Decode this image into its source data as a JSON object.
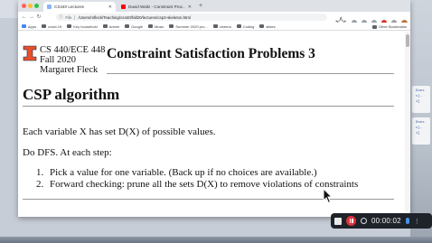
{
  "colors": {
    "accent_red": "#e8502a",
    "rec_red": "#e0323a"
  },
  "tabs": [
    {
      "title": "CS440 Lectures",
      "favicon": "page-icon",
      "active": true
    },
    {
      "title": "David Waltz - Constraint Proc...",
      "favicon": "youtube-icon",
      "active": false
    }
  ],
  "toolbar": {
    "file_label": "File",
    "url": "/Users/mfleck/Teaching/cs440/fall20/lectures/csp3-skeleton.html"
  },
  "bookmarks": [
    "Apps",
    "covid-19",
    "Key household",
    "Admin",
    "Google",
    "Music",
    "Summer 2020 pro...",
    "cinema",
    "Coding",
    "slides"
  ],
  "other_bookmarks": "Other Bookmarks",
  "doc": {
    "course_line1": "CS 440/ECE 448",
    "course_line2": "Fall 2020",
    "author": "Margaret Fleck",
    "lecture_title": "Constraint Satisfaction Problems 3",
    "section_heading": "CSP algorithm",
    "para1": "Each variable X has set D(X) of possible values.",
    "para2": "Do DFS. At each step:",
    "steps": [
      "Pick a value for one variable. (Back up if no choices are available.)",
      "Forward checking: prune all the sets D(X) to remove violations of constraints"
    ]
  },
  "side_fragments": [
    "Does",
    "c]-",
    "1]",
    "Does",
    "c]-",
    "1]"
  ],
  "recording": {
    "time": "00:00:02"
  }
}
